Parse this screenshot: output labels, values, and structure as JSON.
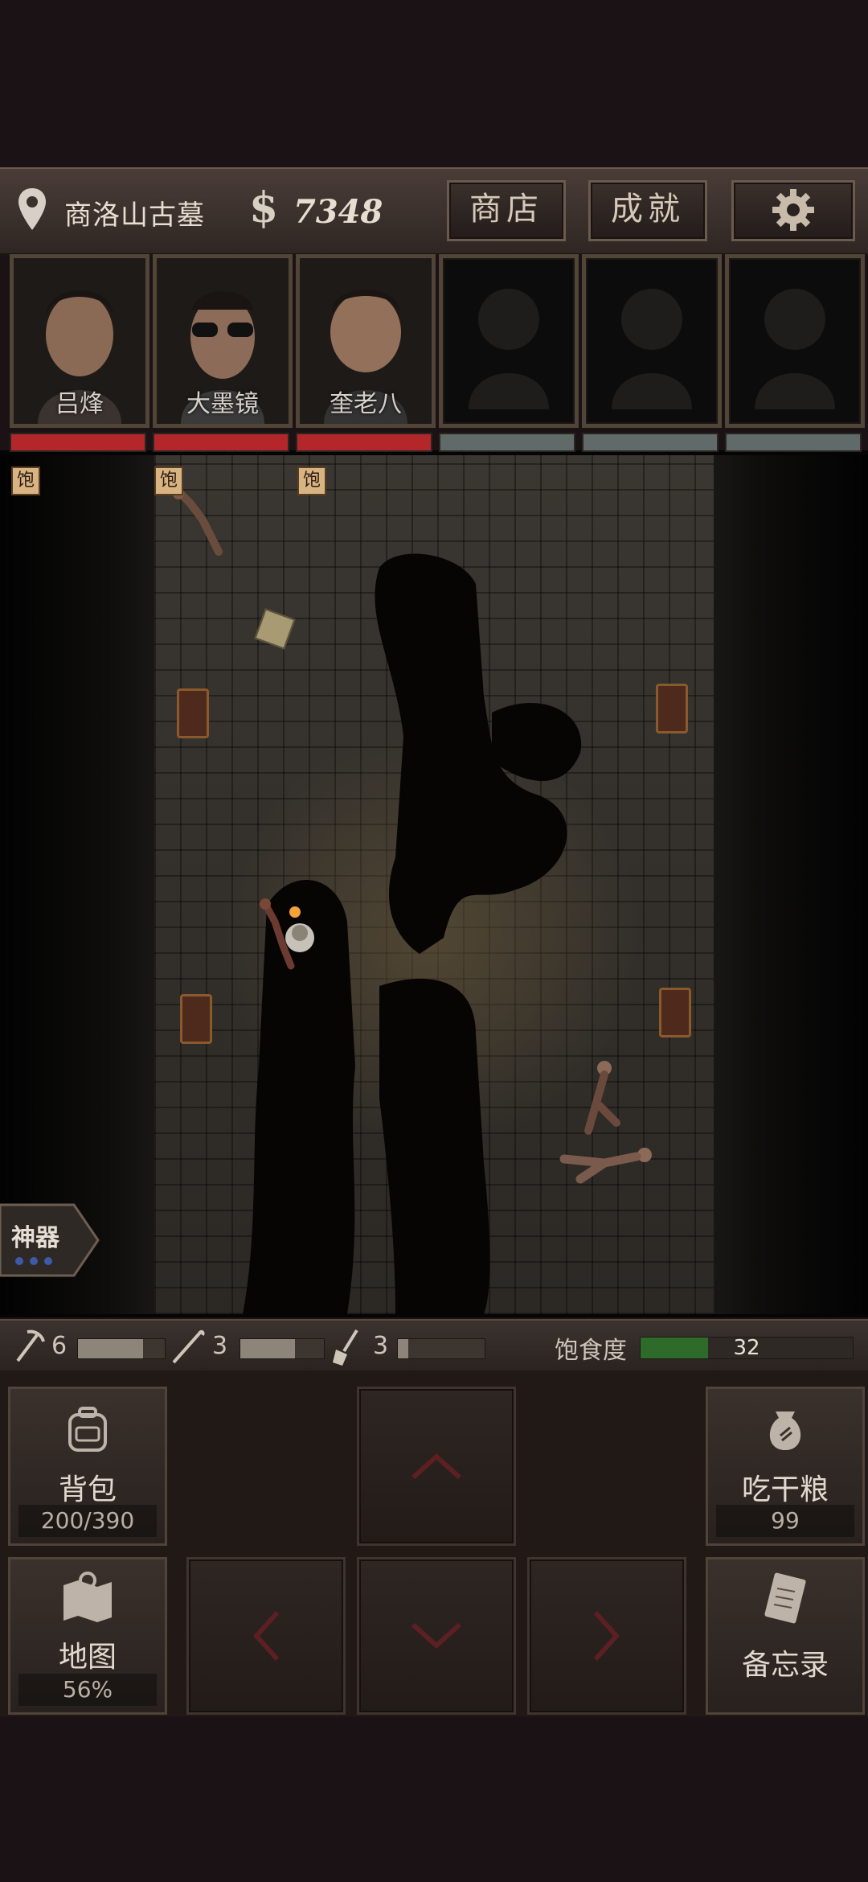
{
  "topbar": {
    "location": "商洛山古墓",
    "currency_symbol": "$",
    "money": "7348",
    "shop_label": "商店",
    "achievements_label": "成就"
  },
  "team": [
    {
      "name": "吕烽",
      "status": "饱",
      "hp_color": "#b3262a"
    },
    {
      "name": "大墨镜",
      "status": "饱",
      "hp_color": "#b3262a"
    },
    {
      "name": "奎老八",
      "status": "饱",
      "hp_color": "#b3262a"
    },
    {
      "name": "",
      "status": "",
      "hp_color": "#5f6a69"
    },
    {
      "name": "",
      "status": "",
      "hp_color": "#5f6a69"
    },
    {
      "name": "",
      "status": "",
      "hp_color": "#5f6a69"
    }
  ],
  "artifact": {
    "label": "神器"
  },
  "tools": [
    {
      "icon": "pickaxe-icon",
      "count": "6",
      "level": 0.75
    },
    {
      "icon": "crowbar-icon",
      "count": "3",
      "level": 0.65
    },
    {
      "icon": "shovel-icon",
      "count": "3",
      "level": 0.12
    }
  ],
  "satiety": {
    "label": "饱食度",
    "value": "32",
    "level": 0.32
  },
  "controls": {
    "backpack_label": "背包",
    "backpack_value": "200/390",
    "eat_label": "吃干粮",
    "eat_value": "99",
    "map_label": "地图",
    "map_value": "56%",
    "memo_label": "备忘录"
  },
  "colors": {
    "accent": "#d7c9b8",
    "background": "#1a1214",
    "health": "#b3262a",
    "satiety": "#2e6b2a"
  }
}
